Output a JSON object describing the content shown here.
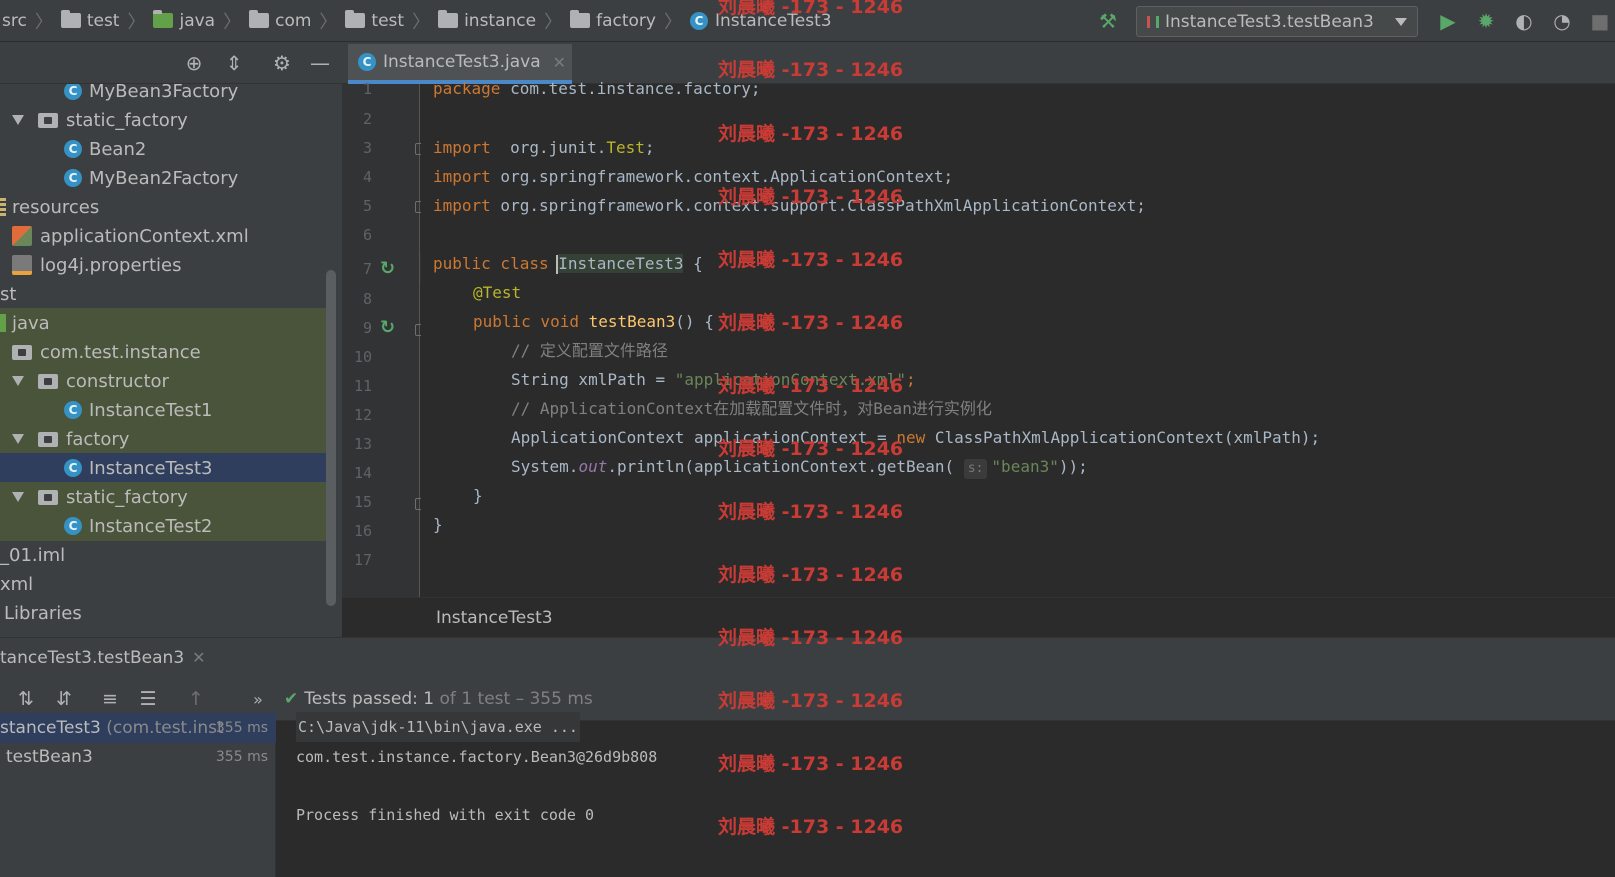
{
  "navbar": {
    "crumbs": [
      "src",
      "test",
      "java",
      "com",
      "test",
      "instance",
      "factory",
      "InstanceTest3"
    ],
    "run_config": "InstanceTest3.testBean3"
  },
  "project_tree": {
    "items": [
      {
        "label": "MyBean3Factory"
      },
      {
        "label": "static_factory"
      },
      {
        "label": "Bean2"
      },
      {
        "label": "MyBean2Factory"
      },
      {
        "label": "resources"
      },
      {
        "label": "applicationContext.xml"
      },
      {
        "label": "log4j.properties"
      },
      {
        "label": "st"
      },
      {
        "label": "java"
      },
      {
        "label": "com.test.instance"
      },
      {
        "label": "constructor"
      },
      {
        "label": "InstanceTest1"
      },
      {
        "label": "factory"
      },
      {
        "label": "InstanceTest3"
      },
      {
        "label": "static_factory"
      },
      {
        "label": "InstanceTest2"
      },
      {
        "label": "_01.iml"
      },
      {
        "label": "xml"
      },
      {
        "label": "Libraries"
      }
    ]
  },
  "editor": {
    "tab_label": "InstanceTest3.java",
    "line_numbers": [
      "1",
      "2",
      "3",
      "4",
      "5",
      "6",
      "7",
      "8",
      "9",
      "10",
      "11",
      "12",
      "13",
      "14",
      "15",
      "16",
      "17"
    ],
    "code": {
      "l1_kw": "package",
      "l1_rest": " com.test.instance.factory;",
      "l3_kw": "import",
      "l3_a": "  org.junit.",
      "l3_b": "Test",
      "l3_c": ";",
      "l4_kw": "import",
      "l4_rest": " org.springframework.context.ApplicationContext;",
      "l5_kw": "import",
      "l5_rest": " org.springframework.context.support.ClassPathXmlApplicationContext;",
      "l7_kw": "public class ",
      "l7_cls": "InstanceTest3",
      "l7_rest": " {",
      "l8_ann": "@Test",
      "l9_kw": "public void ",
      "l9_fn": "testBean3",
      "l9_rest": "() {",
      "l10_cmt": "// 定义配置文件路径",
      "l11_a": "String xmlPath = ",
      "l11_str": "\"applicationContext.xml\"",
      "l11_b": ";",
      "l12_cmt": "// ApplicationContext在加载配置文件时，对Bean进行实例化",
      "l13_a": "ApplicationContext applicationContext = ",
      "l13_kw": "new ",
      "l13_b": "ClassPathXmlApplicationContext(xmlPath);",
      "l14_a": "System.",
      "l14_fld": "out",
      "l14_b": ".println(applicationContext.getBean( ",
      "l14_hint": "s:",
      "l14_str": "\"bean3\"",
      "l14_c": "));",
      "l15": "}",
      "l16": "}"
    },
    "breadcrumb": "InstanceTest3"
  },
  "run_panel": {
    "tab_label": "tanceTest3.testBean3",
    "tests_passed_prefix": "Tests passed: ",
    "tests_passed_count": "1",
    "tests_passed_suffix": " of 1 test – 355 ms",
    "tree": [
      {
        "label": "stanceTest3",
        "pkg": " (com.test.inst",
        "duration": "355 ms"
      },
      {
        "label": "testBean3",
        "duration": "355 ms"
      }
    ],
    "console": [
      "C:\\Java\\jdk-11\\bin\\java.exe ...",
      "com.test.instance.factory.Bean3@26d9b808",
      "",
      "Process finished with exit code 0"
    ]
  },
  "watermark": "刘晨曦 -173 - 1246",
  "colors": {
    "keyword": "#cc7832",
    "annotation": "#bbb529",
    "string": "#6a8759",
    "comment": "#808080",
    "method": "#ffc66d",
    "success": "#59a869",
    "watermark": "#c93b35"
  }
}
